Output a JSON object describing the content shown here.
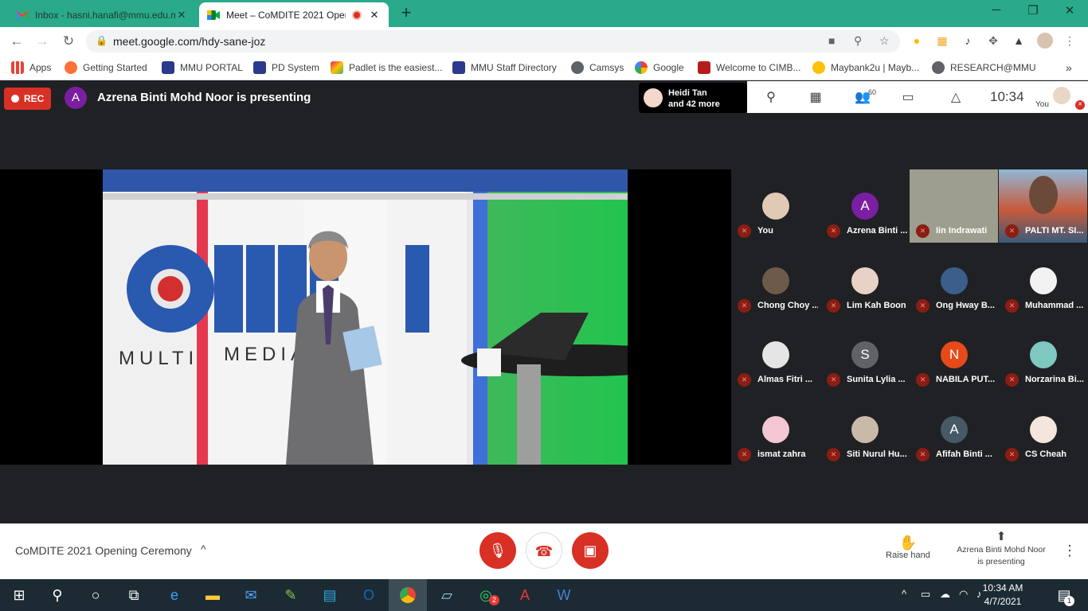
{
  "browser": {
    "tabs": [
      {
        "title": "Inbox - hasni.hanafi@mmu.edu.m",
        "icon": "gmail-icon",
        "active": false
      },
      {
        "title": "Meet – CoMDITE 2021 Open",
        "icon": "google-meet-icon",
        "active": true
      }
    ],
    "url": "meet.google.com/hdy-sane-joz",
    "bookmarks": [
      {
        "label": "Apps",
        "color": "#4285f4"
      },
      {
        "label": "Getting Started",
        "color": "#ff7139"
      },
      {
        "label": "MMU PORTAL",
        "color": "#2b3a8c"
      },
      {
        "label": "PD System",
        "color": "#2b3a8c"
      },
      {
        "label": "Padlet is the easiest...",
        "color": "#e91e63"
      },
      {
        "label": "MMU Staff Directory",
        "color": "#2b3a8c"
      },
      {
        "label": "Camsys",
        "color": "#5f6368"
      },
      {
        "label": "Google",
        "color": "#4285f4"
      },
      {
        "label": "Welcome to CIMB...",
        "color": "#b71c1c"
      },
      {
        "label": "Maybank2u | Mayb...",
        "color": "#ffc107"
      },
      {
        "label": "RESEARCH@MMU",
        "color": "#5f6368"
      }
    ]
  },
  "meet": {
    "rec_label": "REC",
    "presenter_initial": "A",
    "presenting_text": "Azrena Binti Mohd Noor is presenting",
    "speaker_name": "Heidi Tan",
    "speaker_more": "and 42 more",
    "participants_count": "60",
    "clock": "10:34",
    "you_label": "You",
    "participants": [
      {
        "name": "You",
        "initial": "",
        "color": "#e0c9b5"
      },
      {
        "name": "Azrena Binti ...",
        "initial": "A",
        "color": "#7b1fa2"
      },
      {
        "name": "Iin Indrawati",
        "initial": "",
        "color": "#9e9e8e"
      },
      {
        "name": "PALTI MT. SI...",
        "initial": "",
        "color": "#4a6d8c"
      },
      {
        "name": "Chong Choy ...",
        "initial": "",
        "color": "#6d5a4a"
      },
      {
        "name": "Lim Kah Boon",
        "initial": "",
        "color": "#e8d2c5"
      },
      {
        "name": "Ong Hway B...",
        "initial": "",
        "color": "#3b5f8a"
      },
      {
        "name": "Muhammad ...",
        "initial": "",
        "color": "#f2f2f2"
      },
      {
        "name": "Almas Fitri ...",
        "initial": "",
        "color": "#e5e5e5"
      },
      {
        "name": "Sunita Lylia ...",
        "initial": "S",
        "color": "#5f6368"
      },
      {
        "name": "NABILA PUT...",
        "initial": "N",
        "color": "#e64a19"
      },
      {
        "name": "Norzarina Bi...",
        "initial": "",
        "color": "#7fc7c1"
      },
      {
        "name": "ismat zahra",
        "initial": "",
        "color": "#f3c6d3"
      },
      {
        "name": "Siti Nurul Hu...",
        "initial": "",
        "color": "#c9b9a8"
      },
      {
        "name": "Afifah Binti ...",
        "initial": "A",
        "color": "#455a64"
      },
      {
        "name": "CS Cheah",
        "initial": "",
        "color": "#f4e6dc"
      }
    ],
    "meeting_title": "CoMDITE 2021 Opening Ceremony",
    "raise_hand_label": "Raise hand",
    "presenting_footer_1": "Azrena Binti Mohd Noor",
    "presenting_footer_2": "is presenting",
    "video_logo": {
      "left": "MULTI",
      "right": "MEDIA"
    }
  },
  "taskbar": {
    "time": "10:34 AM",
    "date": "4/7/2021",
    "notification_count": "1",
    "whatsapp_badge": "2"
  }
}
